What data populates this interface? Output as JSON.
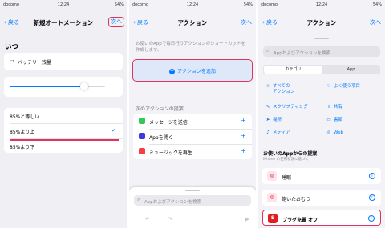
{
  "status": {
    "carrier": "docomo",
    "time": "12:24",
    "battery": "54%"
  },
  "panel1": {
    "back": "戻る",
    "title": "新規オートメーション",
    "next": "次へ",
    "heading": "いつ",
    "trigger": "バッテリー残量",
    "slider_level": 0.78,
    "options": [
      "85%と等しい",
      "85%より上",
      "85%より下"
    ],
    "selected_index": 1
  },
  "panel2": {
    "back": "戻る",
    "title": "アクション",
    "next": "次へ",
    "description": "お使いのAppで毎日行うアクションのショートカットを作成します。",
    "add_action": "アクションを追加",
    "suggestions_title": "次のアクションの提案",
    "suggestions": [
      {
        "label": "メッセージを送信",
        "icon": "messages-icon",
        "color": "#34c759"
      },
      {
        "label": "Appを開く",
        "icon": "open-app-icon",
        "color": "#3a3adf"
      },
      {
        "label": "ミュージックを再生",
        "icon": "music-icon",
        "color": "#fc3c44"
      }
    ],
    "search_placeholder": "Appおよびアクションを検索"
  },
  "panel3": {
    "back": "戻る",
    "title": "アクション",
    "next": "次へ",
    "search_placeholder": "Appおよびアクションを検索",
    "segments": [
      "カテゴリ",
      "App"
    ],
    "categories": [
      {
        "label": "すべての\nアクション",
        "icon": "grid-icon",
        "glyph": "⁝⁝"
      },
      {
        "label": "よく使う項目",
        "icon": "heart-icon",
        "glyph": "♡"
      },
      {
        "label": "スクリプティング",
        "icon": "scripting-icon",
        "glyph": "✎"
      },
      {
        "label": "共有",
        "icon": "share-icon",
        "glyph": "⇧"
      },
      {
        "label": "場所",
        "icon": "location-icon",
        "glyph": "➤"
      },
      {
        "label": "書類",
        "icon": "document-icon",
        "glyph": "▭"
      },
      {
        "label": "メディア",
        "icon": "media-icon",
        "glyph": "♪"
      },
      {
        "label": "Web",
        "icon": "compass-icon",
        "glyph": "◎"
      }
    ],
    "apps_title": "お使いのAppからの提案",
    "apps_subtitle": "iPhone の使用状況に基づく",
    "apps": [
      {
        "label": "睡眠",
        "icon": "sleep-app-icon",
        "color": "#ffe3e8"
      },
      {
        "label": "飽いたおむつ",
        "icon": "diaper-app-icon",
        "color": "#ffe3e8"
      },
      {
        "label": "プラグ充電 オフ",
        "icon": "plug-app-icon",
        "color": "#e02020"
      }
    ]
  }
}
